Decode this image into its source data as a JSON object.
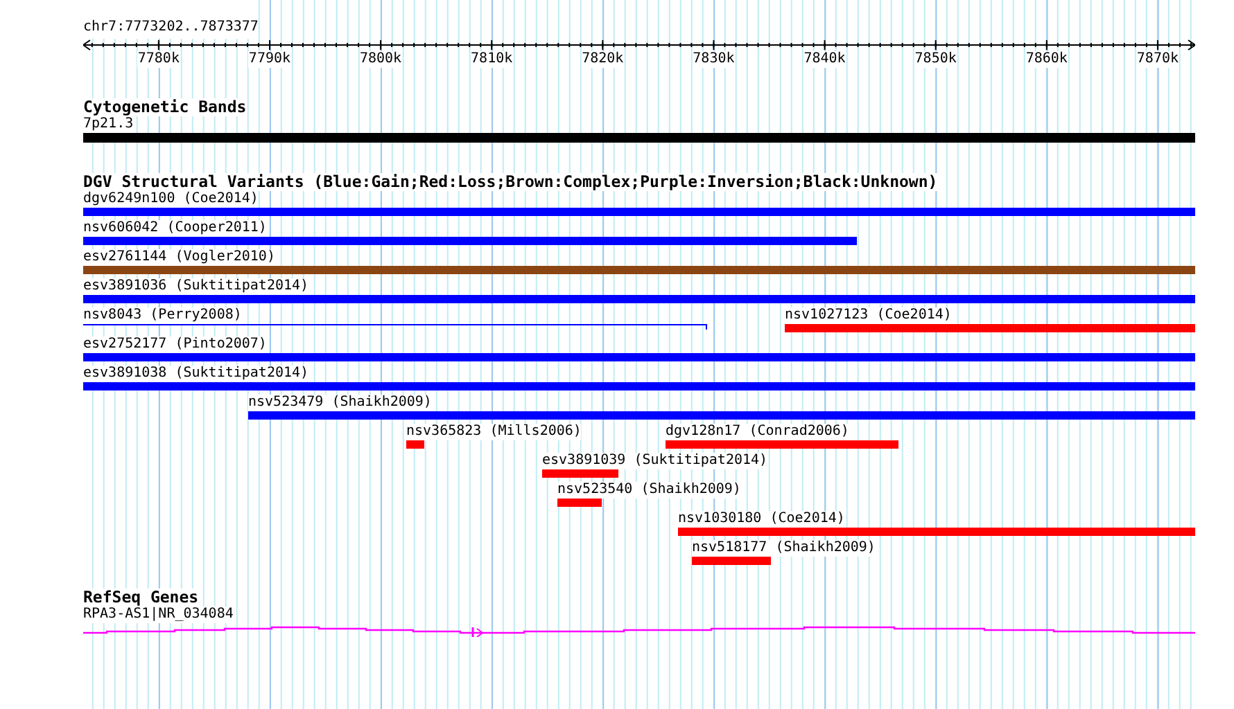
{
  "ruler": {
    "location": "chr7:7773202..7873377",
    "ticks": [
      {
        "label": "7780k"
      },
      {
        "label": "7790k"
      },
      {
        "label": "7800k"
      },
      {
        "label": "7810k"
      },
      {
        "label": "7820k"
      },
      {
        "label": "7830k"
      },
      {
        "label": "7840k"
      },
      {
        "label": "7850k"
      },
      {
        "label": "7860k"
      },
      {
        "label": "7870k"
      }
    ]
  },
  "cytogenetic_bands": {
    "title": "Cytogenetic Bands",
    "bands": [
      {
        "label": "7p21.3"
      }
    ]
  },
  "dgv_track": {
    "title": "DGV Structural Variants (Blue:Gain;Red:Loss;Brown:Complex;Purple:Inversion;Black:Unknown)",
    "rows": [
      {
        "features": [
          {
            "label": "dgv6249n100 (Coe2014)",
            "color": "#0000ff",
            "kind": "bar"
          }
        ]
      },
      {
        "features": [
          {
            "label": "nsv606042 (Cooper2011)",
            "color": "#0000ff",
            "kind": "bar"
          }
        ]
      },
      {
        "features": [
          {
            "label": "esv2761144 (Vogler2010)",
            "color": "#8b4513",
            "kind": "bar"
          }
        ]
      },
      {
        "features": [
          {
            "label": "esv3891036 (Suktitipat2014)",
            "color": "#0000ff",
            "kind": "bar"
          }
        ]
      },
      {
        "features": [
          {
            "label": "nsv8043 (Perry2008)",
            "color": "#0000ff",
            "kind": "line"
          },
          {
            "label": "nsv1027123 (Coe2014)",
            "color": "#ff0000",
            "kind": "bar"
          }
        ]
      },
      {
        "features": [
          {
            "label": "esv2752177 (Pinto2007)",
            "color": "#0000ff",
            "kind": "bar"
          }
        ]
      },
      {
        "features": [
          {
            "label": "esv3891038 (Suktitipat2014)",
            "color": "#0000ff",
            "kind": "bar"
          }
        ]
      },
      {
        "features": [
          {
            "label": "nsv523479 (Shaikh2009)",
            "color": "#0000ff",
            "kind": "bar"
          }
        ]
      },
      {
        "features": [
          {
            "label": "nsv365823 (Mills2006)",
            "color": "#ff0000",
            "kind": "bar"
          },
          {
            "label": "dgv128n17 (Conrad2006)",
            "color": "#ff0000",
            "kind": "bar"
          }
        ]
      },
      {
        "features": [
          {
            "label": "esv3891039 (Suktitipat2014)",
            "color": "#ff0000",
            "kind": "bar"
          }
        ]
      },
      {
        "features": [
          {
            "label": "nsv523540 (Shaikh2009)",
            "color": "#ff0000",
            "kind": "bar"
          }
        ]
      },
      {
        "features": [
          {
            "label": "nsv1030180 (Coe2014)",
            "color": "#ff0000",
            "kind": "bar"
          }
        ]
      },
      {
        "features": [
          {
            "label": "nsv518177 (Shaikh2009)",
            "color": "#ff0000",
            "kind": "bar"
          }
        ]
      }
    ]
  },
  "refseq_track": {
    "title": "RefSeq Genes",
    "genes": [
      {
        "label": "RPA3-AS1|NR_034084"
      }
    ]
  }
}
